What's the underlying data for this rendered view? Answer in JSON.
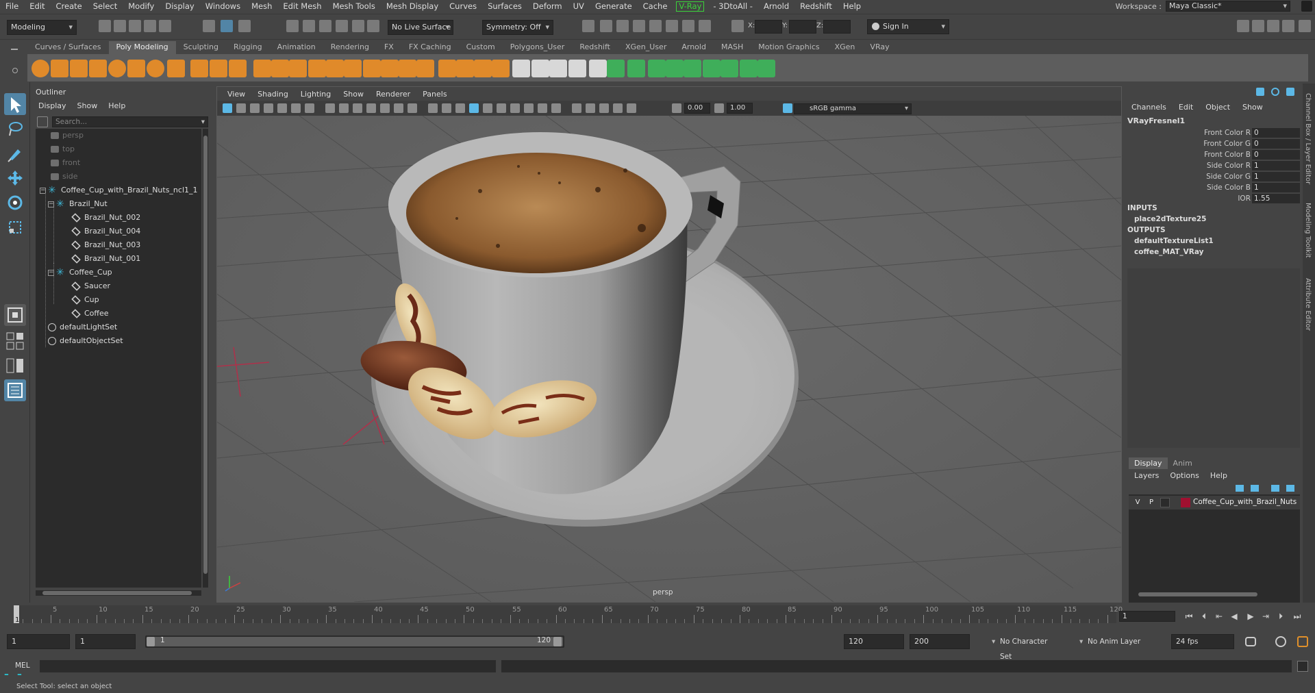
{
  "menubar": {
    "items": [
      "File",
      "Edit",
      "Create",
      "Select",
      "Modify",
      "Display",
      "Windows",
      "Mesh",
      "Edit Mesh",
      "Mesh Tools",
      "Mesh Display",
      "Curves",
      "Surfaces",
      "Deform",
      "UV",
      "Generate",
      "Cache",
      "V-Ray",
      "- 3DtoAll -",
      "Arnold",
      "Redshift",
      "Help"
    ],
    "workspace_label": "Workspace :",
    "workspace_value": "Maya Classic*"
  },
  "statusline": {
    "menuset": "Modeling",
    "live_surface": "No Live Surface",
    "symmetry": "Symmetry: Off",
    "x_label": "X:",
    "y_label": "Y:",
    "z_label": "Z:",
    "sign_in": "Sign In"
  },
  "shelf": {
    "tabs": [
      "Curves / Surfaces",
      "Poly Modeling",
      "Sculpting",
      "Rigging",
      "Animation",
      "Rendering",
      "FX",
      "FX Caching",
      "Custom",
      "Polygons_User",
      "Redshift",
      "XGen_User",
      "Arnold",
      "MASH",
      "Motion Graphics",
      "XGen",
      "VRay"
    ],
    "active_tab": "Poly Modeling"
  },
  "outliner": {
    "title": "Outliner",
    "menu": [
      "Display",
      "Show",
      "Help"
    ],
    "search_placeholder": "Search...",
    "items": [
      {
        "label": "persp",
        "type": "camera"
      },
      {
        "label": "top",
        "type": "camera"
      },
      {
        "label": "front",
        "type": "camera"
      },
      {
        "label": "side",
        "type": "camera"
      },
      {
        "label": "Coffee_Cup_with_Brazil_Nuts_ncl1_1",
        "type": "group"
      },
      {
        "label": "Brazil_Nut",
        "type": "group"
      },
      {
        "label": "Brazil_Nut_002",
        "type": "mesh"
      },
      {
        "label": "Brazil_Nut_004",
        "type": "mesh"
      },
      {
        "label": "Brazil_Nut_003",
        "type": "mesh"
      },
      {
        "label": "Brazil_Nut_001",
        "type": "mesh"
      },
      {
        "label": "Coffee_Cup",
        "type": "group"
      },
      {
        "label": "Saucer",
        "type": "mesh"
      },
      {
        "label": "Cup",
        "type": "mesh"
      },
      {
        "label": "Coffee",
        "type": "mesh"
      },
      {
        "label": "defaultLightSet",
        "type": "set"
      },
      {
        "label": "defaultObjectSet",
        "type": "set"
      }
    ]
  },
  "viewport": {
    "menu": [
      "View",
      "Shading",
      "Lighting",
      "Show",
      "Renderer",
      "Panels"
    ],
    "exposure": "0.00",
    "gamma": "1.00",
    "color_space": "sRGB gamma",
    "camera_name": "persp"
  },
  "channel_box": {
    "tabs": [
      "Channels",
      "Edit",
      "Object",
      "Show"
    ],
    "node": "VRayFresnel1",
    "attributes": [
      {
        "label": "Front Color R",
        "value": "0"
      },
      {
        "label": "Front Color G",
        "value": "0"
      },
      {
        "label": "Front Color B",
        "value": "0"
      },
      {
        "label": "Side Color R",
        "value": "1"
      },
      {
        "label": "Side Color G",
        "value": "1"
      },
      {
        "label": "Side Color B",
        "value": "1"
      },
      {
        "label": "IOR",
        "value": "1.55"
      }
    ],
    "inputs_label": "INPUTS",
    "inputs": [
      "place2dTexture25"
    ],
    "outputs_label": "OUTPUTS",
    "outputs": [
      "defaultTextureList1",
      "coffee_MAT_VRay"
    ]
  },
  "layer_editor": {
    "tabs": [
      "Display",
      "Anim"
    ],
    "active_tab": "Display",
    "menu": [
      "Layers",
      "Options",
      "Help"
    ],
    "layer": {
      "v": "V",
      "p": "P",
      "name": "Coffee_Cup_with_Brazil_Nuts",
      "color": "#a01030"
    }
  },
  "side_tabs": [
    "Channel Box / Layer Editor",
    "Modeling Toolkit",
    "Attribute Editor"
  ],
  "timeslider": {
    "tick_labels": [
      "5",
      "10",
      "15",
      "20",
      "25",
      "30",
      "35",
      "40",
      "45",
      "50",
      "55",
      "60",
      "65",
      "70",
      "75",
      "80",
      "85",
      "90",
      "95",
      "100",
      "105",
      "110",
      "115",
      "120"
    ],
    "current_frame_marker": "1",
    "current_frame": "1"
  },
  "rangeslider": {
    "start": "1",
    "playback_start": "1",
    "bar_start": "1",
    "bar_end": "120",
    "playback_end": "120",
    "end": "200",
    "character_set": "No Character Set",
    "anim_layer": "No Anim Layer",
    "fps": "24 fps"
  },
  "cmdline": {
    "label": "MEL"
  },
  "helpline": {
    "text": "Select Tool: select an object"
  },
  "colors": {
    "accent_blue": "#5285a6",
    "vray_green": "#3bd33b",
    "maya_teal": "#2bb8c5",
    "shelf_orange": "#e08a2a",
    "shelf_green": "#3fae5a"
  }
}
